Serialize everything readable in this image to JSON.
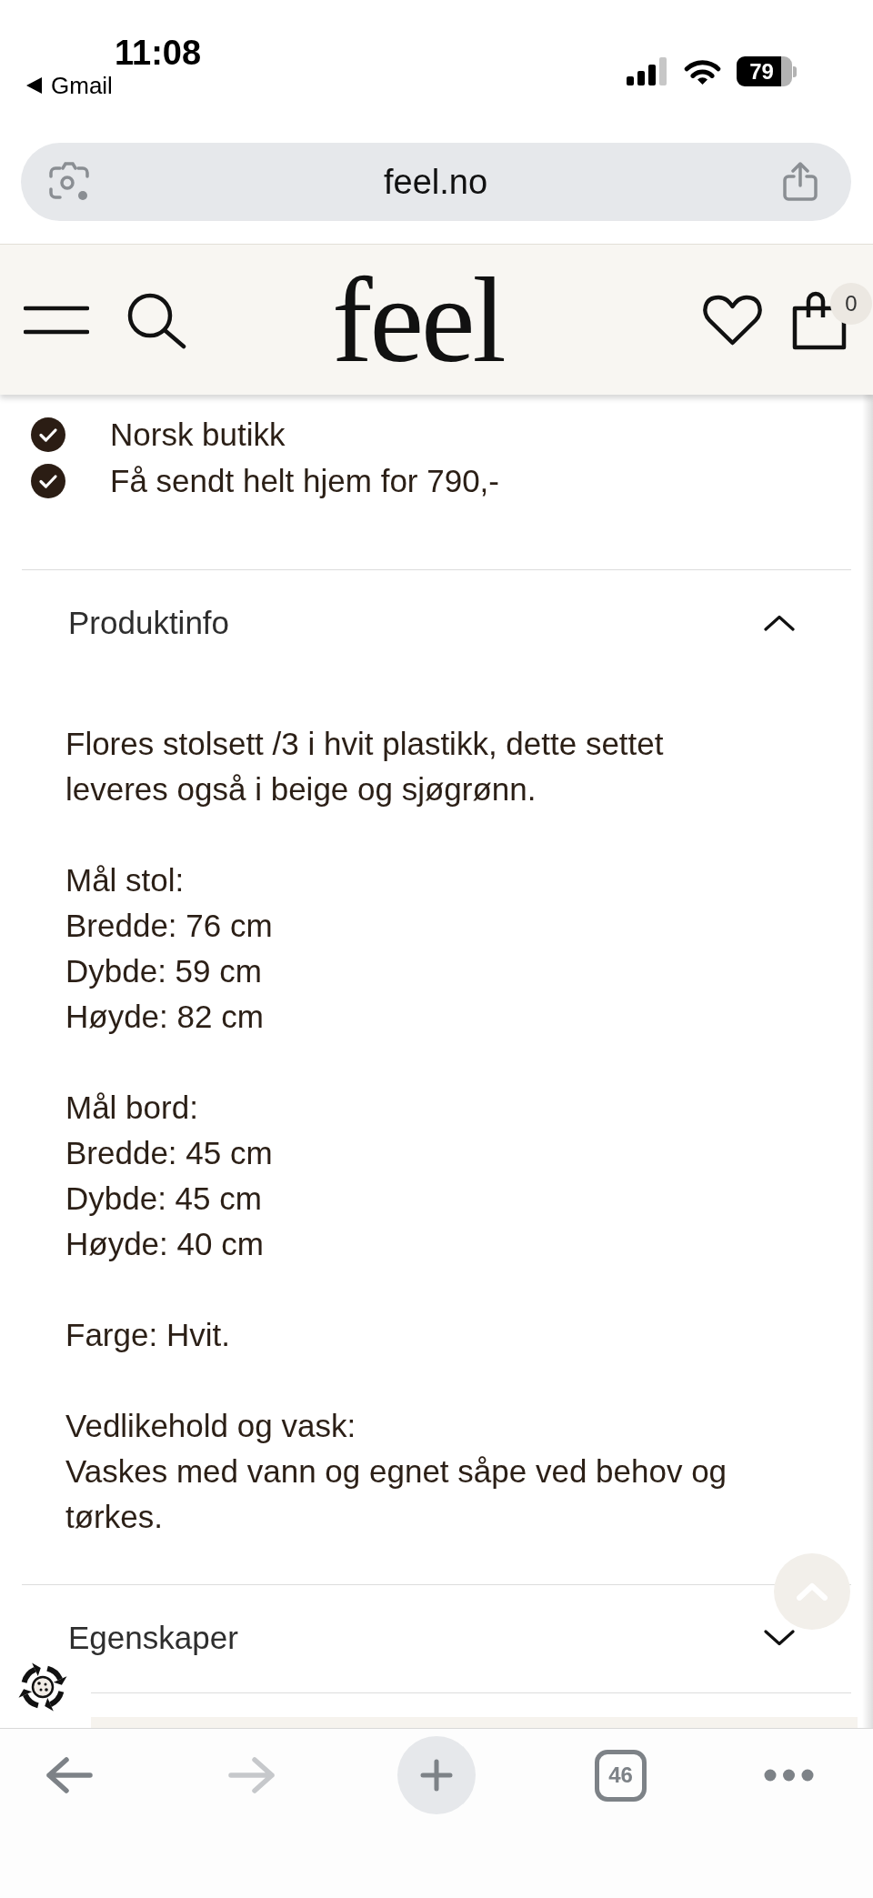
{
  "status_bar": {
    "time": "11:08",
    "back_link": "Gmail",
    "battery": "79"
  },
  "address_bar": {
    "url": "feel.no"
  },
  "site_header": {
    "logo": "feel",
    "cart_count": "0"
  },
  "usp_list": [
    "Norsk butikk",
    "Få sendt helt hjem for 790,-"
  ],
  "accordion": [
    {
      "title": "Produktinfo",
      "expanded": true,
      "content": [
        [
          "Flores stolsett /3 i hvit plastikk, dette settet leveres også i beige og sjøgrønn."
        ],
        [
          "Mål stol:",
          "Bredde: 76 cm",
          "Dybde: 59 cm",
          "Høyde: 82 cm"
        ],
        [
          "Mål bord:",
          "Bredde: 45 cm",
          "Dybde: 45 cm",
          "Høyde: 40 cm"
        ],
        [
          "Farge: Hvit."
        ],
        [
          "Vedlikehold og vask:",
          "Vaskes med vann og egnet såpe ved behov og tørkes."
        ]
      ]
    },
    {
      "title": "Egenskaper",
      "expanded": false
    }
  ],
  "toolbar": [
    {
      "kind": "back",
      "disabled": false
    },
    {
      "kind": "forward",
      "disabled": true
    },
    {
      "kind": "new_tab",
      "disabled": false
    },
    {
      "kind": "tabs",
      "label": "46",
      "disabled": false
    },
    {
      "kind": "more",
      "disabled": false
    }
  ]
}
